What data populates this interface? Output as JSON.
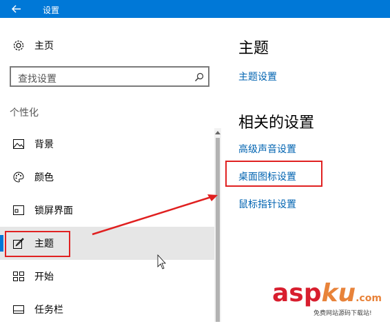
{
  "titlebar": {
    "title": "设置",
    "back_icon": "arrow-left-icon"
  },
  "sidebar": {
    "home_label": "主页",
    "search_placeholder": "查找设置",
    "section_label": "个性化",
    "items": [
      {
        "label": "背景",
        "icon": "picture-icon"
      },
      {
        "label": "颜色",
        "icon": "palette-icon"
      },
      {
        "label": "锁屏界面",
        "icon": "lock-screen-icon"
      },
      {
        "label": "主题",
        "icon": "brush-icon",
        "selected": true
      },
      {
        "label": "开始",
        "icon": "start-grid-icon"
      },
      {
        "label": "任务栏",
        "icon": "taskbar-icon"
      }
    ]
  },
  "main": {
    "theme_heading": "主题",
    "theme_settings_link": "主题设置",
    "related_heading": "相关的设置",
    "links": [
      "高级声音设置",
      "桌面图标设置",
      "鼠标指针设置"
    ]
  },
  "watermark": {
    "main_red": "asp",
    "main_orange": "ku",
    "suffix": ".com",
    "subtitle": "免费网站源码下载站!"
  },
  "colors": {
    "accent": "#0078d7",
    "link": "#0063b1",
    "annotation": "#e02020"
  }
}
